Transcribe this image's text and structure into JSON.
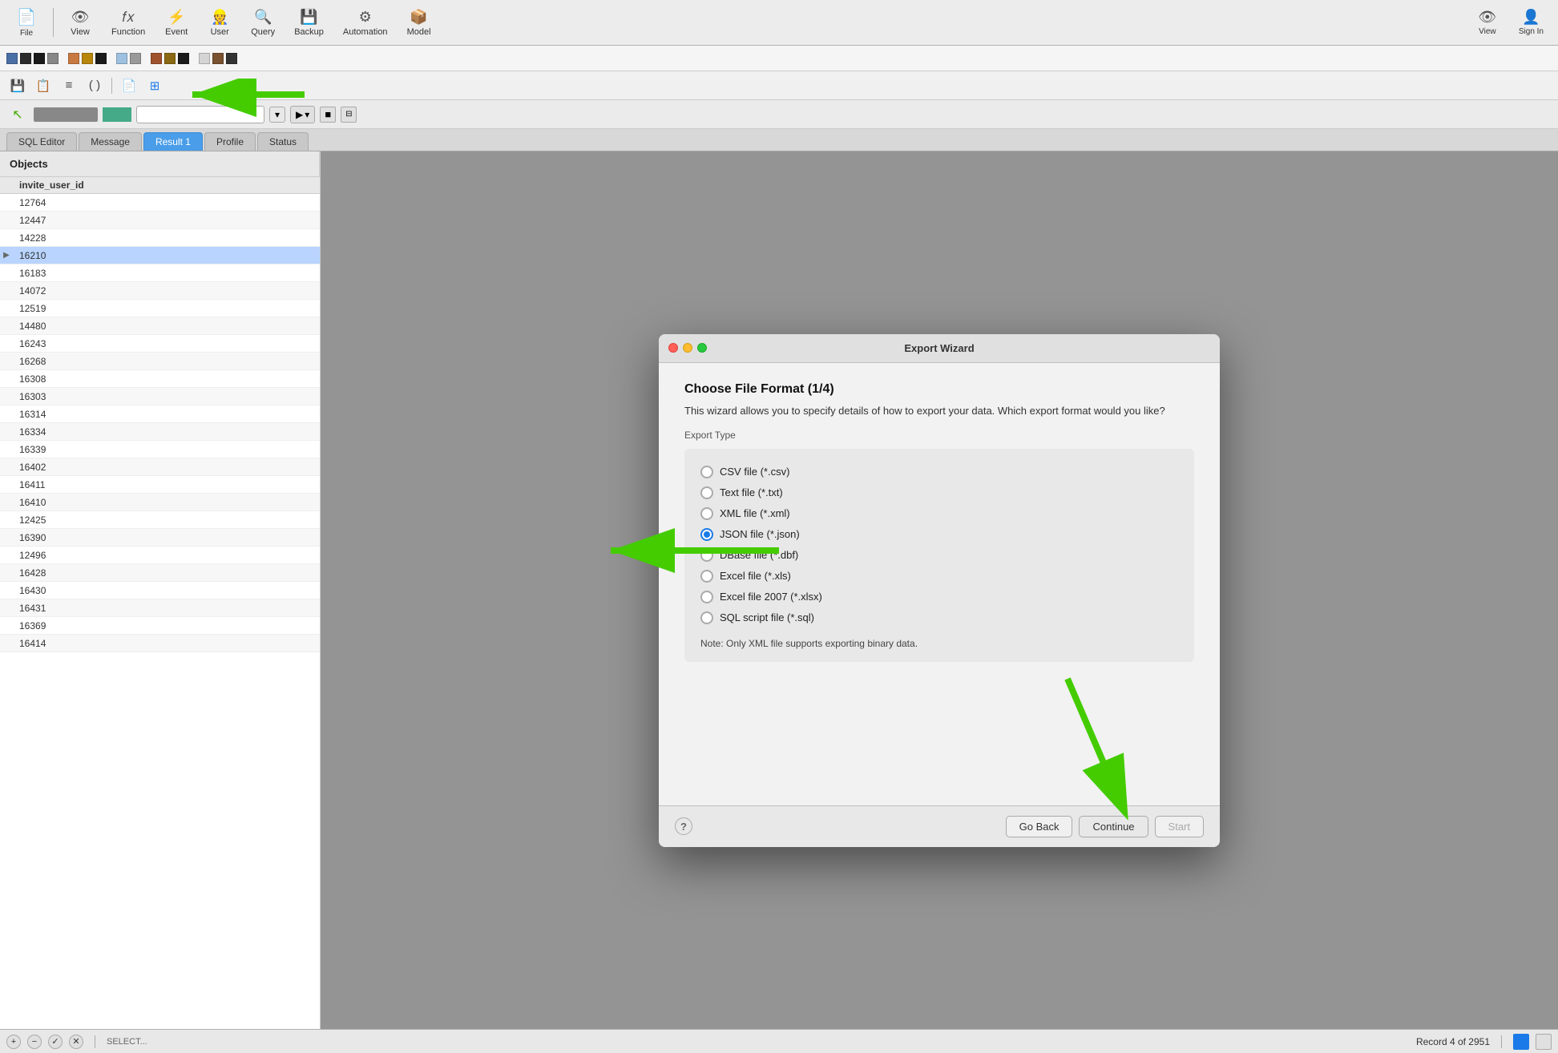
{
  "app": {
    "title": "Export Wizard"
  },
  "toolbar": {
    "items": [
      {
        "id": "view",
        "label": "View",
        "icon": "👁"
      },
      {
        "id": "function",
        "label": "Function",
        "icon": "𝑓"
      },
      {
        "id": "event",
        "label": "Event",
        "icon": "⚡"
      },
      {
        "id": "user",
        "label": "User",
        "icon": "👷"
      },
      {
        "id": "query",
        "label": "Query",
        "icon": "🔍"
      },
      {
        "id": "backup",
        "label": "Backup",
        "icon": "💾"
      },
      {
        "id": "automation",
        "label": "Automation",
        "icon": "⚙"
      },
      {
        "id": "model",
        "label": "Model",
        "icon": "📦"
      }
    ],
    "right_items": [
      {
        "id": "view-right",
        "label": "View",
        "icon": "👁"
      },
      {
        "id": "sign-in",
        "label": "Sign In",
        "icon": "👤"
      }
    ]
  },
  "swatches": {
    "colors": [
      "#4a6fa5",
      "#2b2b2b",
      "#1a1a1a",
      "#888",
      "#c87941",
      "#b8860b",
      "#1a1a1a",
      "#999",
      "#a0522d",
      "#8b6914",
      "#1a1a1a",
      "#c0c0c0",
      "#7a5230",
      "#333"
    ]
  },
  "tabs": {
    "items": [
      {
        "id": "sql-editor",
        "label": "SQL Editor",
        "active": false
      },
      {
        "id": "message",
        "label": "Message",
        "active": false
      },
      {
        "id": "result-1",
        "label": "Result 1",
        "active": true
      },
      {
        "id": "profile",
        "label": "Profile",
        "active": false
      },
      {
        "id": "status",
        "label": "Status",
        "active": false
      }
    ]
  },
  "left_panel": {
    "header": "Objects",
    "column_header": "invite_user_id",
    "rows": [
      {
        "value": "12764",
        "selected": false,
        "current": false
      },
      {
        "value": "12447",
        "selected": false,
        "current": false
      },
      {
        "value": "14228",
        "selected": false,
        "current": false
      },
      {
        "value": "16210",
        "selected": false,
        "current": true
      },
      {
        "value": "16183",
        "selected": false,
        "current": false
      },
      {
        "value": "14072",
        "selected": false,
        "current": false
      },
      {
        "value": "12519",
        "selected": false,
        "current": false
      },
      {
        "value": "14480",
        "selected": false,
        "current": false
      },
      {
        "value": "16243",
        "selected": false,
        "current": false
      },
      {
        "value": "16268",
        "selected": false,
        "current": false
      },
      {
        "value": "16308",
        "selected": false,
        "current": false
      },
      {
        "value": "16303",
        "selected": false,
        "current": false
      },
      {
        "value": "16314",
        "selected": false,
        "current": false
      },
      {
        "value": "16334",
        "selected": false,
        "current": false
      },
      {
        "value": "16339",
        "selected": false,
        "current": false
      },
      {
        "value": "16402",
        "selected": false,
        "current": false
      },
      {
        "value": "16411",
        "selected": false,
        "current": false
      },
      {
        "value": "16410",
        "selected": false,
        "current": false
      },
      {
        "value": "12425",
        "selected": false,
        "current": false
      },
      {
        "value": "16390",
        "selected": false,
        "current": false
      },
      {
        "value": "12496",
        "selected": false,
        "current": false
      },
      {
        "value": "16428",
        "selected": false,
        "current": false
      },
      {
        "value": "16430",
        "selected": false,
        "current": false
      },
      {
        "value": "16431",
        "selected": false,
        "current": false
      },
      {
        "value": "16369",
        "selected": false,
        "current": false
      },
      {
        "value": "16414",
        "selected": false,
        "current": false
      }
    ]
  },
  "dialog": {
    "title": "Export Wizard",
    "heading": "Choose File Format (1/4)",
    "description": "This wizard allows you to specify details of how to export your data. Which export format would you like?",
    "section_label": "Export Type",
    "options": [
      {
        "id": "csv",
        "label": "CSV file (*.csv)",
        "selected": false
      },
      {
        "id": "txt",
        "label": "Text file (*.txt)",
        "selected": false
      },
      {
        "id": "xml",
        "label": "XML file (*.xml)",
        "selected": false
      },
      {
        "id": "json",
        "label": "JSON file (*.json)",
        "selected": true
      },
      {
        "id": "dbf",
        "label": "DBase file (*.dbf)",
        "selected": false
      },
      {
        "id": "xls",
        "label": "Excel file (*.xls)",
        "selected": false
      },
      {
        "id": "xlsx",
        "label": "Excel file 2007 (*.xlsx)",
        "selected": false
      },
      {
        "id": "sql",
        "label": "SQL script file (*.sql)",
        "selected": false
      }
    ],
    "note": "Note: Only XML file supports exporting binary data.",
    "buttons": {
      "help": "?",
      "go_back": "Go Back",
      "continue": "Continue",
      "start": "Start"
    }
  },
  "status_bar": {
    "text": "Record 4 of 2951",
    "add_label": "+",
    "remove_label": "−",
    "check_label": "✓",
    "x_label": "✕"
  }
}
